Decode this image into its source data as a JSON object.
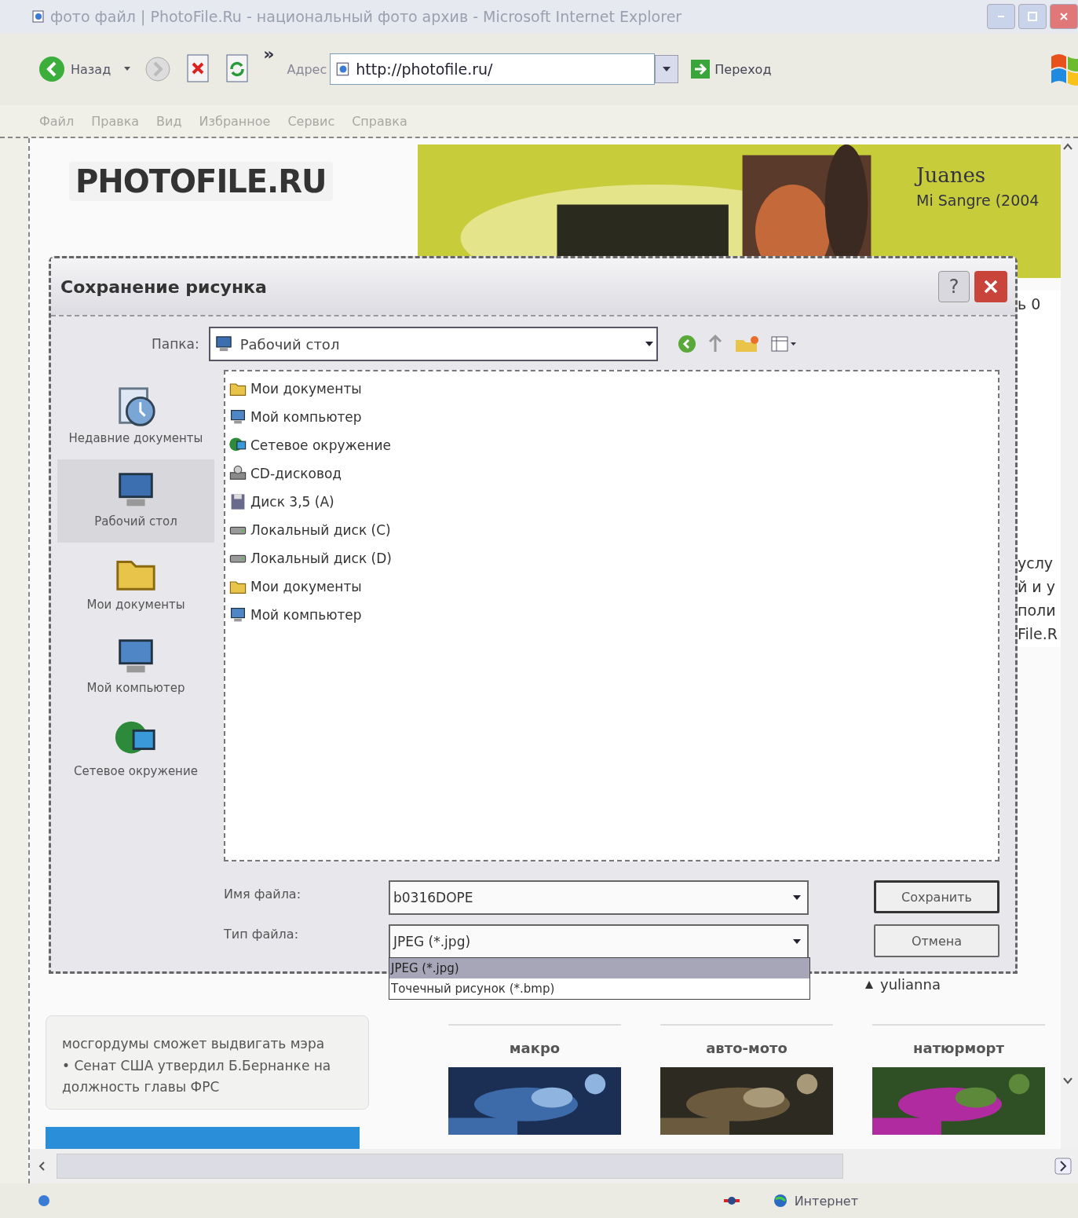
{
  "window": {
    "title": "фото файл | PhotoFile.Ru - национальный фото архив - Microsoft Internet Explorer"
  },
  "toolbar": {
    "back": "Назад",
    "more": "»",
    "address_label": "Адрес",
    "address": "http://photofile.ru/",
    "go": "Переход"
  },
  "menu": [
    "Файл",
    "Правка",
    "Вид",
    "Избранное",
    "Сервис",
    "Справка"
  ],
  "page": {
    "logo": "PHOTOFILE.RU",
    "banner": {
      "artist": "Juanes",
      "album": "Mi Sangre (2004"
    },
    "side_fragments": [
      "ь 0",
      "услу",
      "й и у",
      "поли",
      "File.R"
    ],
    "news": [
      "мосгордумы сможет выдвигать мэра",
      "• Сенат США утвердил Б.Бернанке на должность главы ФРС"
    ],
    "user": "yulianna",
    "categories": [
      {
        "title": "макро",
        "kind": "picture"
      },
      {
        "title": "авто-мото",
        "kind": "picture"
      },
      {
        "title": "натюрморт",
        "kind": "picture"
      }
    ]
  },
  "dialog": {
    "title": "Сохранение рисунка",
    "help": "?",
    "folder_label": "Папка:",
    "folder": "Рабочий стол",
    "places": [
      {
        "label": "Недавние документы",
        "kind": "recent",
        "selected": false
      },
      {
        "label": "Рабочий стол",
        "kind": "desktop",
        "selected": true
      },
      {
        "label": "Мои документы",
        "kind": "docs",
        "selected": false
      },
      {
        "label": "Мой компьютер",
        "kind": "computer",
        "selected": false
      },
      {
        "label": "Сетевое окружение",
        "kind": "network",
        "selected": false
      }
    ],
    "files": [
      {
        "name": "Мои документы",
        "kind": "docs"
      },
      {
        "name": "Мой компьютер",
        "kind": "computer"
      },
      {
        "name": "Сетевое окружение",
        "kind": "network"
      },
      {
        "name": "CD-дисковод",
        "kind": "cd"
      },
      {
        "name": "Диск 3,5 (A)",
        "kind": "floppy"
      },
      {
        "name": "Локальный диск (C)",
        "kind": "disk"
      },
      {
        "name": "Локальный диск (D)",
        "kind": "disk"
      },
      {
        "name": "Мои документы",
        "kind": "docs"
      },
      {
        "name": "Мой компьютер",
        "kind": "computer"
      }
    ],
    "filename_label": "Имя файла:",
    "filename": "b0316DOPE",
    "filetype_label": "Тип файла:",
    "filetype": "JPEG (*.jpg)",
    "filetype_options": [
      {
        "label": "JPEG (*.jpg)",
        "selected": true
      },
      {
        "label": "Точечный рисунок (*.bmp)",
        "selected": false
      }
    ],
    "save": "Сохранить",
    "cancel": "Отмена"
  },
  "status_bar": {
    "zone": "Интернет"
  }
}
